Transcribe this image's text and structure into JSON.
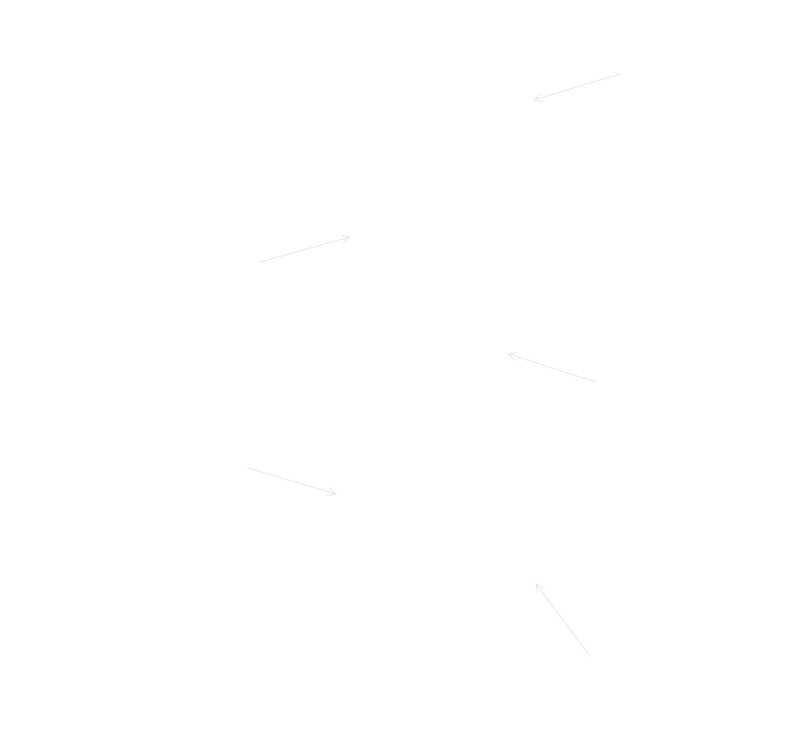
{
  "diagram": {
    "background_color": "#ffffff",
    "arrow_color": "#e6e6e6",
    "arrows": [
      {
        "name": "arrow-1",
        "icon": "arrow-icon"
      },
      {
        "name": "arrow-2",
        "icon": "arrow-icon"
      },
      {
        "name": "arrow-3",
        "icon": "arrow-icon"
      },
      {
        "name": "arrow-4",
        "icon": "arrow-icon"
      },
      {
        "name": "arrow-5",
        "icon": "arrow-icon"
      }
    ]
  }
}
